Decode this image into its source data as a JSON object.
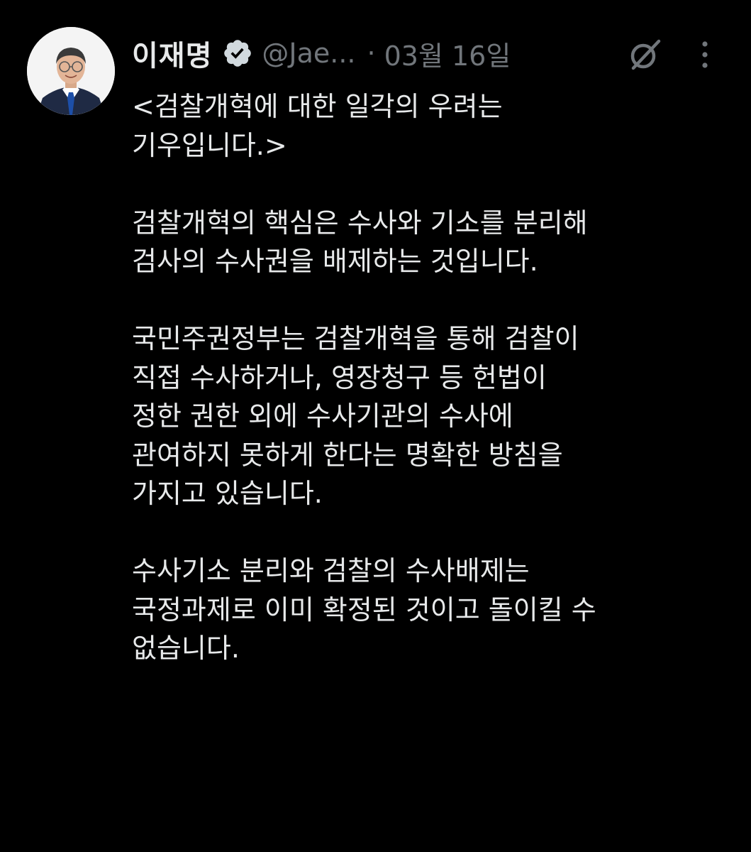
{
  "post": {
    "author": {
      "display_name": "이재명",
      "handle": "@Jae...",
      "verified": true,
      "avatar_icon": "profile-photo"
    },
    "separator": "·",
    "date": "03월 16일",
    "icons": {
      "grok": "grok-icon",
      "more": "more-options-icon"
    },
    "colors": {
      "background": "#000000",
      "text": "#e7e9ea",
      "secondary_text": "#71767b",
      "verified_badge": "#d1d9de"
    },
    "paragraphs": [
      {
        "lines": [
          "<검찰개혁에 대한 일각의 우려는",
          "기우입니다.>"
        ]
      },
      {
        "lines": [
          "검찰개혁의 핵심은 수사와 기소를 분리해",
          "검사의 수사권을 배제하는 것입니다."
        ]
      },
      {
        "lines": [
          "국민주권정부는 검찰개혁을 통해 검찰이",
          "직접 수사하거나, 영장청구 등 헌법이",
          "정한 권한 외에 수사기관의 수사에",
          "관여하지 못하게 한다는 명확한 방침을",
          "가지고 있습니다."
        ]
      },
      {
        "lines": [
          "수사기소 분리와 검찰의 수사배제는",
          "국정과제로 이미 확정된 것이고 돌이킬 수",
          "없습니다."
        ]
      }
    ]
  }
}
